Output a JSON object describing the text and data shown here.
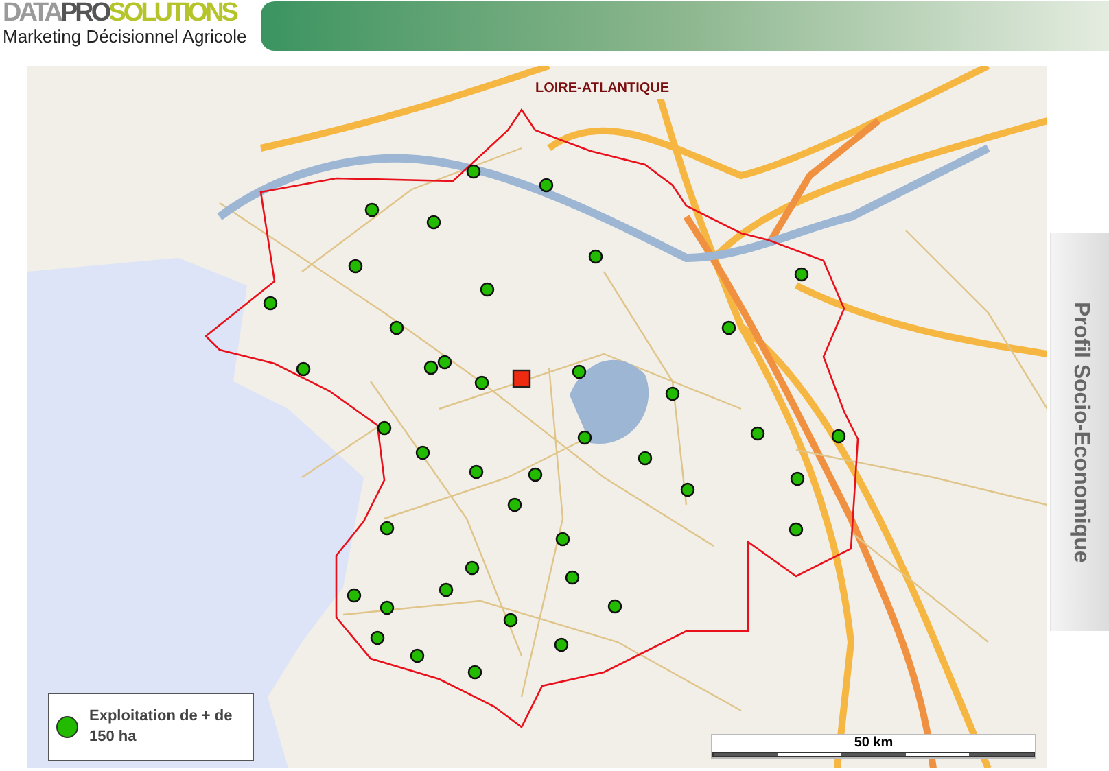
{
  "header": {
    "logo": {
      "part_1": "DATA",
      "part_2": "PRO",
      "part_3": "SOLUTIONS",
      "tagline": "Marketing Décisionnel Agricole"
    }
  },
  "map": {
    "region_label": "LOIRE-ATLANTIQUE",
    "legend": {
      "label": "Exploitation de + de 150 ha",
      "color": "#22bb00"
    },
    "scale_label": "50 km"
  },
  "side_tab": {
    "label": "Profil Socio-Economique"
  }
}
